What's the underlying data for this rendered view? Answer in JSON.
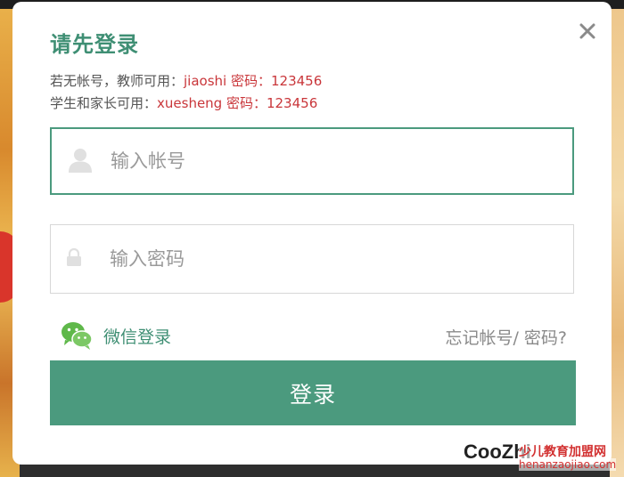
{
  "modal": {
    "title": "请先登录",
    "info": {
      "teacher_prefix": "若无帐号，教师可用：",
      "teacher_creds": "jiaoshi  密码：123456",
      "student_prefix": "学生和家长可用：",
      "student_creds": "xuesheng  密码：123456"
    },
    "account_field": {
      "placeholder": "输入帐号",
      "value": ""
    },
    "password_field": {
      "placeholder": "输入密码",
      "value": ""
    },
    "wechat_login": "微信登录",
    "forgot": "忘记帐号/ 密码?",
    "login_button": "登录"
  },
  "watermark": {
    "logo": "CooZhi",
    "site_name": "少儿教育加盟网",
    "url": "henanzaojiao.com"
  },
  "colors": {
    "accent": "#4b9a7e",
    "title": "#3f8f74",
    "highlight": "#c9363a",
    "wechat": "#5fb84a"
  },
  "icons": [
    "close-icon",
    "user-icon",
    "lock-icon",
    "wechat-icon"
  ]
}
